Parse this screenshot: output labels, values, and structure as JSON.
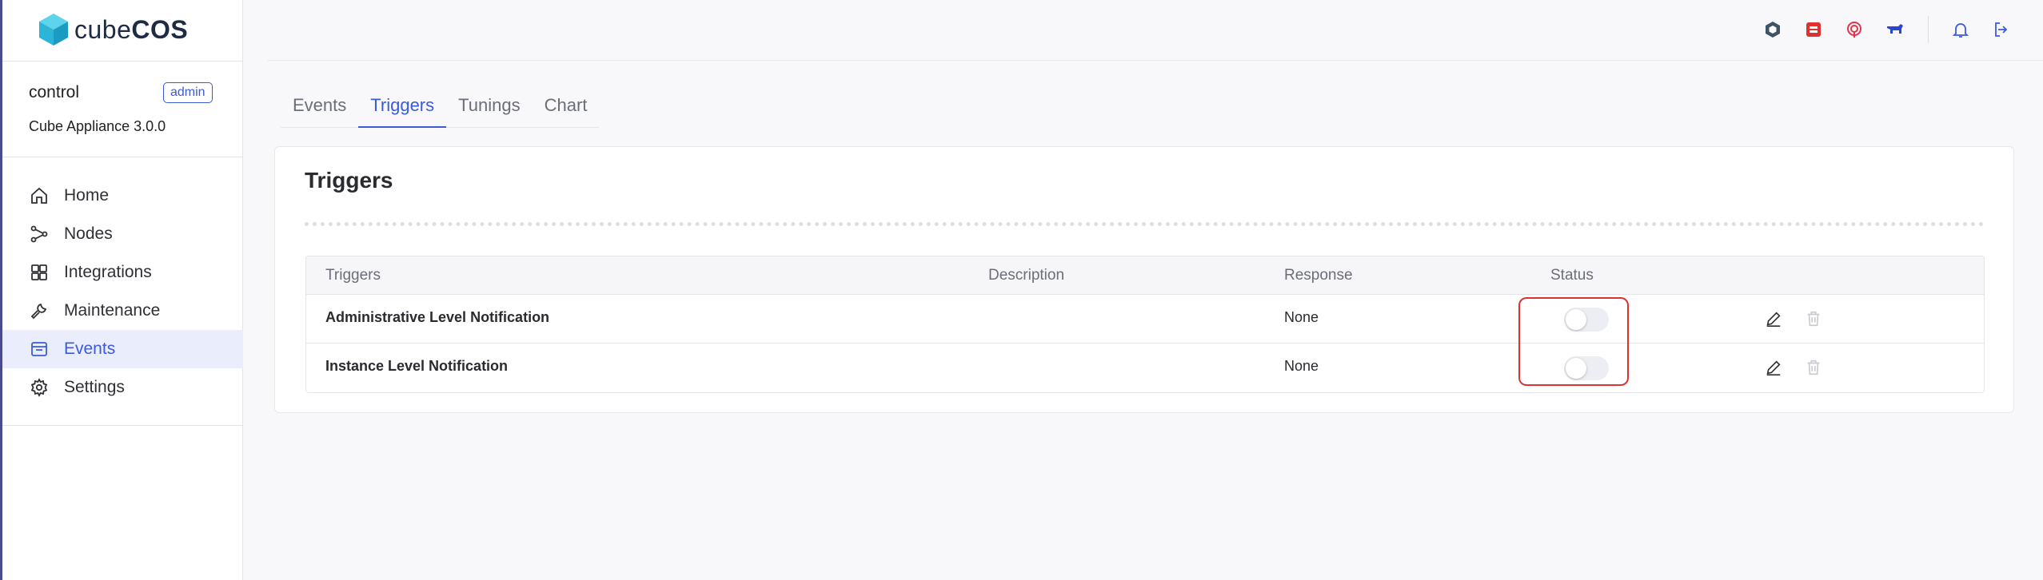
{
  "brand": {
    "name_part1": "cube",
    "name_part2": "COS"
  },
  "user": {
    "name": "control",
    "role": "admin",
    "appliance": "Cube Appliance 3.0.0"
  },
  "nav": {
    "items": [
      {
        "label": "Home",
        "icon": "home-icon",
        "active": false
      },
      {
        "label": "Nodes",
        "icon": "nodes-icon",
        "active": false
      },
      {
        "label": "Integrations",
        "icon": "integrations-icon",
        "active": false
      },
      {
        "label": "Maintenance",
        "icon": "wrench-icon",
        "active": false
      },
      {
        "label": "Events",
        "icon": "events-icon",
        "active": true
      },
      {
        "label": "Settings",
        "icon": "gear-icon",
        "active": false
      }
    ]
  },
  "topbar": {
    "icons": [
      "openstack-icon",
      "server-icon",
      "ceph-icon",
      "moose-icon",
      "bell-icon",
      "logout-icon"
    ]
  },
  "tabs": [
    "Events",
    "Triggers",
    "Tunings",
    "Chart"
  ],
  "active_tab": "Triggers",
  "card": {
    "title": "Triggers"
  },
  "table": {
    "headers": [
      "Triggers",
      "Description",
      "Response",
      "Status"
    ],
    "rows": [
      {
        "name": "Administrative Level Notification",
        "description": "",
        "response": "None",
        "enabled": false
      },
      {
        "name": "Instance Level Notification",
        "description": "",
        "response": "None",
        "enabled": false
      }
    ]
  },
  "colors": {
    "accent": "#3b5bdb",
    "highlight": "#e03131",
    "rail": "#4a4b8f"
  }
}
